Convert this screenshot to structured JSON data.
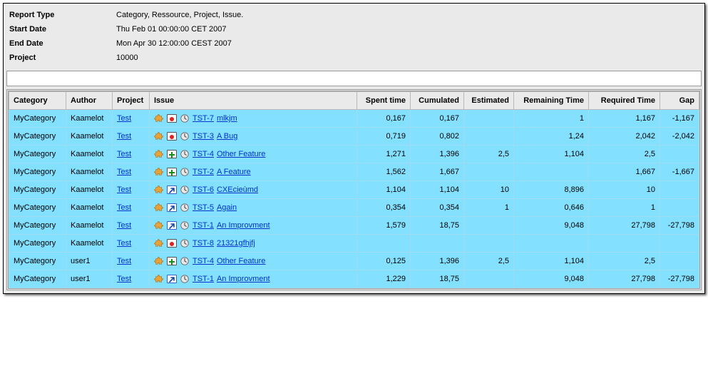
{
  "meta": {
    "report_type_label": "Report Type",
    "report_type": "Category, Ressource, Project, Issue.",
    "start_date_label": "Start Date",
    "start_date": "Thu Feb 01 00:00:00 CET 2007",
    "end_date_label": "End Date",
    "end_date": "Mon Apr 30 12:00:00 CEST 2007",
    "project_label": "Project",
    "project": "10000"
  },
  "columns": {
    "category": "Category",
    "author": "Author",
    "project": "Project",
    "issue": "Issue",
    "spent": "Spent time",
    "cumulated": "Cumulated",
    "estimated": "Estimated",
    "remaining": "Remaining Time",
    "required": "Required Time",
    "gap": "Gap"
  },
  "project_link": "Test",
  "rows": [
    {
      "category": "MyCategory",
      "author": "Kaamelot",
      "type": "bug",
      "key": "TST-7",
      "summary": "mlkjm",
      "spent": "0,167",
      "cum": "0,167",
      "est": "",
      "rem": "1",
      "req": "1,167",
      "gap": "-1,167"
    },
    {
      "category": "MyCategory",
      "author": "Kaamelot",
      "type": "bug",
      "key": "TST-3",
      "summary": "A Bug",
      "spent": "0,719",
      "cum": "0,802",
      "est": "",
      "rem": "1,24",
      "req": "2,042",
      "gap": "-2,042"
    },
    {
      "category": "MyCategory",
      "author": "Kaamelot",
      "type": "feature",
      "key": "TST-4",
      "summary": "Other Feature",
      "spent": "1,271",
      "cum": "1,396",
      "est": "2,5",
      "rem": "1,104",
      "req": "2,5",
      "gap": ""
    },
    {
      "category": "MyCategory",
      "author": "Kaamelot",
      "type": "feature",
      "key": "TST-2",
      "summary": "A Feature",
      "spent": "1,562",
      "cum": "1,667",
      "est": "",
      "rem": "",
      "req": "1,667",
      "gap": "-1,667"
    },
    {
      "category": "MyCategory",
      "author": "Kaamelot",
      "type": "improvement",
      "key": "TST-6",
      "summary": "CXEcieùmd",
      "spent": "1,104",
      "cum": "1,104",
      "est": "10",
      "rem": "8,896",
      "req": "10",
      "gap": ""
    },
    {
      "category": "MyCategory",
      "author": "Kaamelot",
      "type": "improvement",
      "key": "TST-5",
      "summary": "Again",
      "spent": "0,354",
      "cum": "0,354",
      "est": "1",
      "rem": "0,646",
      "req": "1",
      "gap": ""
    },
    {
      "category": "MyCategory",
      "author": "Kaamelot",
      "type": "improvement",
      "key": "TST-1",
      "summary": "An Improvment",
      "spent": "1,579",
      "cum": "18,75",
      "est": "",
      "rem": "9,048",
      "req": "27,798",
      "gap": "-27,798"
    },
    {
      "category": "MyCategory",
      "author": "Kaamelot",
      "type": "bug",
      "key": "TST-8",
      "summary": "21321gfhjfj",
      "spent": "",
      "cum": "",
      "est": "",
      "rem": "",
      "req": "",
      "gap": ""
    },
    {
      "category": "MyCategory",
      "author": "user1",
      "type": "feature",
      "key": "TST-4",
      "summary": "Other Feature",
      "spent": "0,125",
      "cum": "1,396",
      "est": "2,5",
      "rem": "1,104",
      "req": "2,5",
      "gap": ""
    },
    {
      "category": "MyCategory",
      "author": "user1",
      "type": "improvement",
      "key": "TST-1",
      "summary": "An Improvment",
      "spent": "1,229",
      "cum": "18,75",
      "est": "",
      "rem": "9,048",
      "req": "27,798",
      "gap": "-27,798"
    }
  ]
}
